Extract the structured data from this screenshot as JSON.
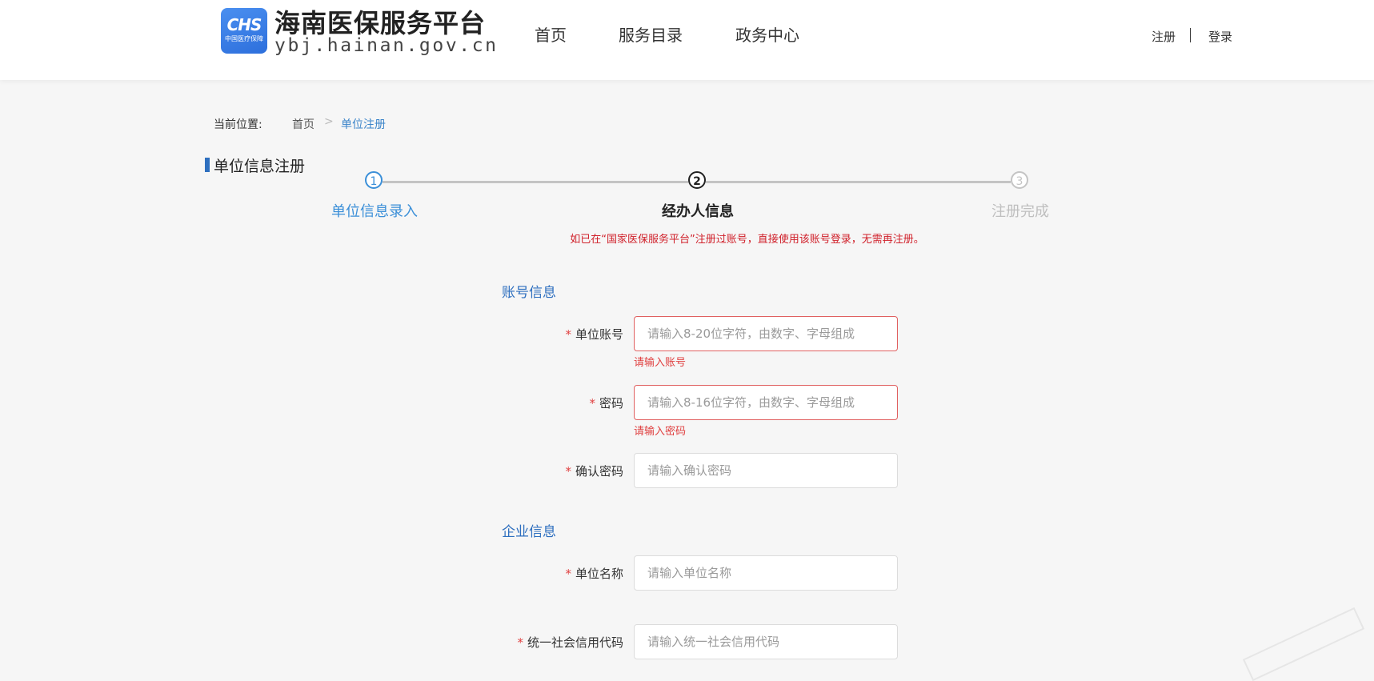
{
  "header": {
    "logo_text": "CHS",
    "logo_subtext": "中国医疗保障",
    "site_title": "海南医保服务平台",
    "site_url": "ybj.hainan.gov.cn",
    "nav": [
      "首页",
      "服务目录",
      "政务中心"
    ],
    "register_label": "注册",
    "login_label": "登录"
  },
  "breadcrumb": {
    "label": "当前位置:",
    "home": "首页",
    "separator": ">",
    "current": "单位注册"
  },
  "section_title": "单位信息注册",
  "steps": [
    {
      "number": "1",
      "label": "单位信息录入",
      "state": "done"
    },
    {
      "number": "2",
      "label": "经办人信息",
      "state": "active"
    },
    {
      "number": "3",
      "label": "注册完成",
      "state": "pending"
    }
  ],
  "notice": "如已在“国家医保服务平台”注册过账号，直接使用该账号登录，无需再注册。",
  "account_group": {
    "title": "账号信息",
    "required_mark": "*",
    "fields": [
      {
        "label": "单位账号",
        "placeholder": "请输入8-20位字符，由数字、字母组成",
        "error": "请输入账号"
      },
      {
        "label": "密码",
        "placeholder": "请输入8-16位字符，由数字、字母组成",
        "error": "请输入密码"
      },
      {
        "label": "确认密码",
        "placeholder": "请输入确认密码",
        "error": ""
      }
    ]
  },
  "company_group": {
    "title": "企业信息",
    "fields": [
      {
        "label": "单位名称",
        "placeholder": "请输入单位名称"
      },
      {
        "label": "统一社会信用代码",
        "placeholder": "请输入统一社会信用代码"
      }
    ]
  },
  "colors": {
    "accent": "#3b8fd8",
    "brand": "#2e6fbf",
    "error": "#e04040",
    "notice": "#d0202a"
  }
}
